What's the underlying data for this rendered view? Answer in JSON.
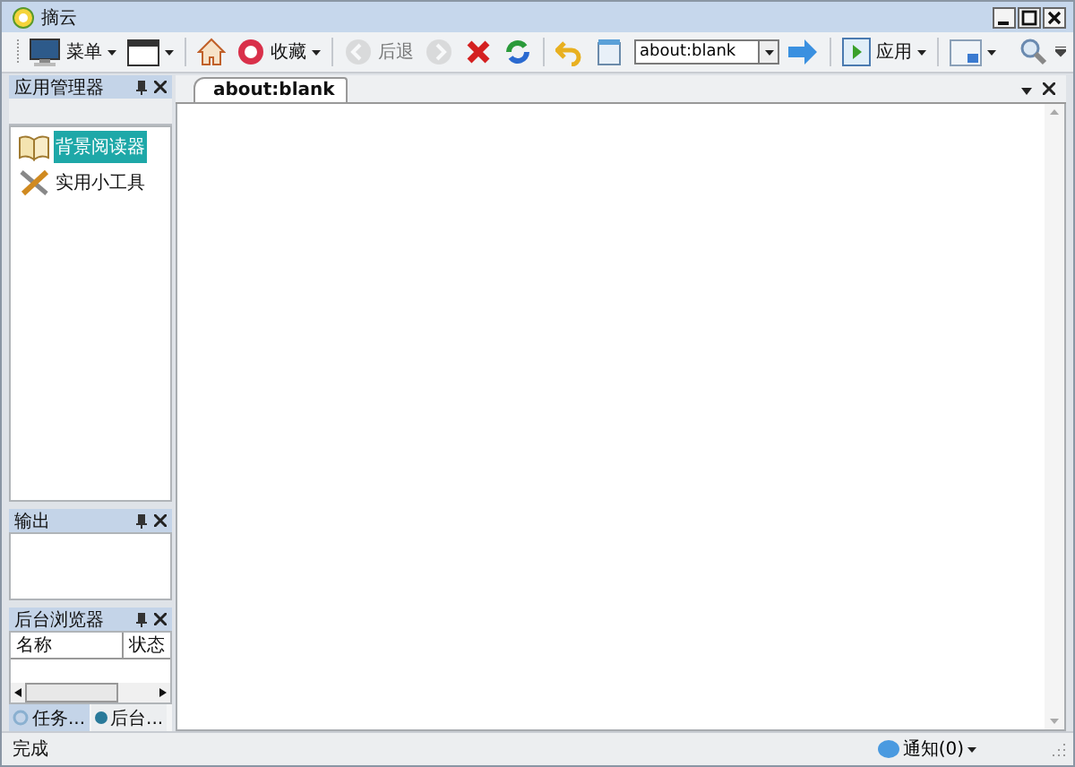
{
  "window": {
    "title": "摘云"
  },
  "toolbar": {
    "menu": "菜单",
    "favorites": "收藏",
    "back": {
      "label": "后退",
      "disabled": true
    },
    "forward": {
      "disabled": true
    },
    "address": {
      "value": "about:blank"
    },
    "apps": "应用"
  },
  "panels": [
    {
      "title": "应用管理器",
      "items": [
        {
          "label": "背景阅读器",
          "selected": true
        },
        {
          "label": "实用小工具",
          "selected": false
        }
      ]
    },
    {
      "title": "输出"
    },
    {
      "title": "后台浏览器",
      "columns": [
        "名称",
        "状态"
      ]
    }
  ],
  "bottom_tabs": [
    {
      "label": "任务...",
      "selected": true
    },
    {
      "label": "后台...",
      "selected": false
    }
  ],
  "tabs": [
    {
      "label": "about:blank",
      "selected": true
    }
  ],
  "status_bar": {
    "text": "完成",
    "notifications": "通知(0)"
  }
}
